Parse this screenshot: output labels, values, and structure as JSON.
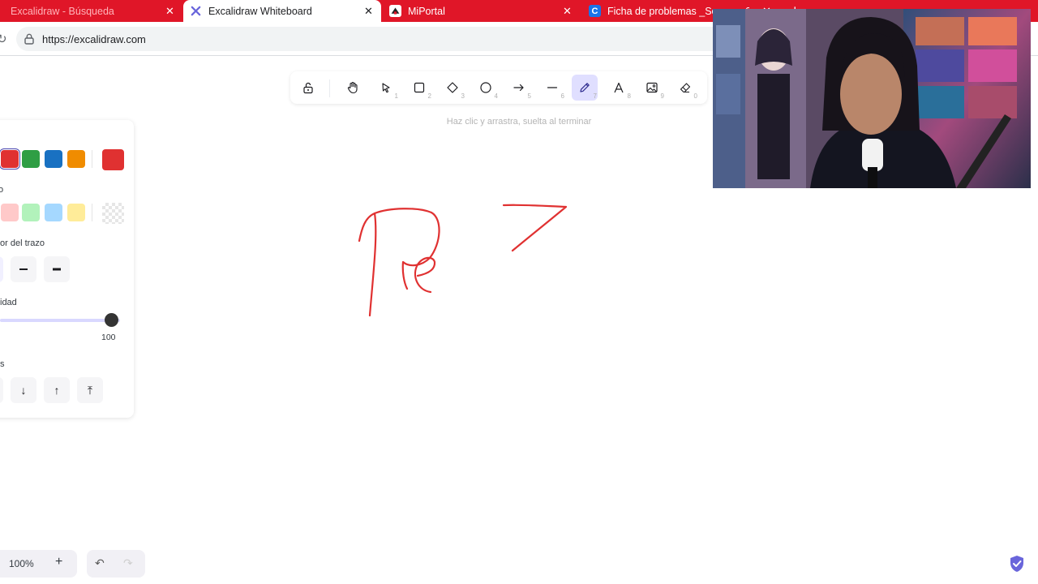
{
  "browser": {
    "tabs": [
      {
        "title": "Excalidraw - Búsqueda",
        "close": "✕"
      },
      {
        "title": "Excalidraw Whiteboard",
        "close": "✕"
      },
      {
        "title": "MiPortal",
        "close": "✕"
      },
      {
        "title": "Ficha de problemas _Semana 02.d",
        "close": "✕",
        "favicon": "C"
      }
    ],
    "new_tab": "+",
    "url": "https://excalidraw.com"
  },
  "toolbar": {
    "tools": [
      {
        "name": "lock",
        "key": ""
      },
      {
        "name": "hand",
        "key": ""
      },
      {
        "name": "selection",
        "key": "1"
      },
      {
        "name": "rectangle",
        "key": "2"
      },
      {
        "name": "diamond",
        "key": "3"
      },
      {
        "name": "ellipse",
        "key": "4"
      },
      {
        "name": "arrow",
        "key": "5"
      },
      {
        "name": "line",
        "key": "6"
      },
      {
        "name": "draw",
        "key": "7",
        "active": true
      },
      {
        "name": "text",
        "key": "8"
      },
      {
        "name": "image",
        "key": "9"
      },
      {
        "name": "eraser",
        "key": "0"
      }
    ],
    "hint": "Haz clic y arrastra, suelta al terminar"
  },
  "panel": {
    "stroke_colors": [
      "#e03131",
      "#2f9e44",
      "#1971c2",
      "#f08c00"
    ],
    "stroke_selected": "#e03131",
    "background_label": "o",
    "background_colors": [
      "#ffc9c9",
      "#b2f2bb",
      "#a5d8ff",
      "#ffec99"
    ],
    "stroke_width_label": "or del trazo",
    "opacity_label": "idad",
    "opacity_value": "100",
    "opacity_level": 1.0,
    "layers_label": "s",
    "layer_buttons": [
      "↓",
      "↑",
      "⤒"
    ]
  },
  "footer": {
    "zoom": "100%",
    "zoom_in": "+",
    "undo": "↶",
    "redo": "↷"
  },
  "colors": {
    "tabbar": "#e01628",
    "accent": "#6965db",
    "stroke": "#e03131"
  }
}
